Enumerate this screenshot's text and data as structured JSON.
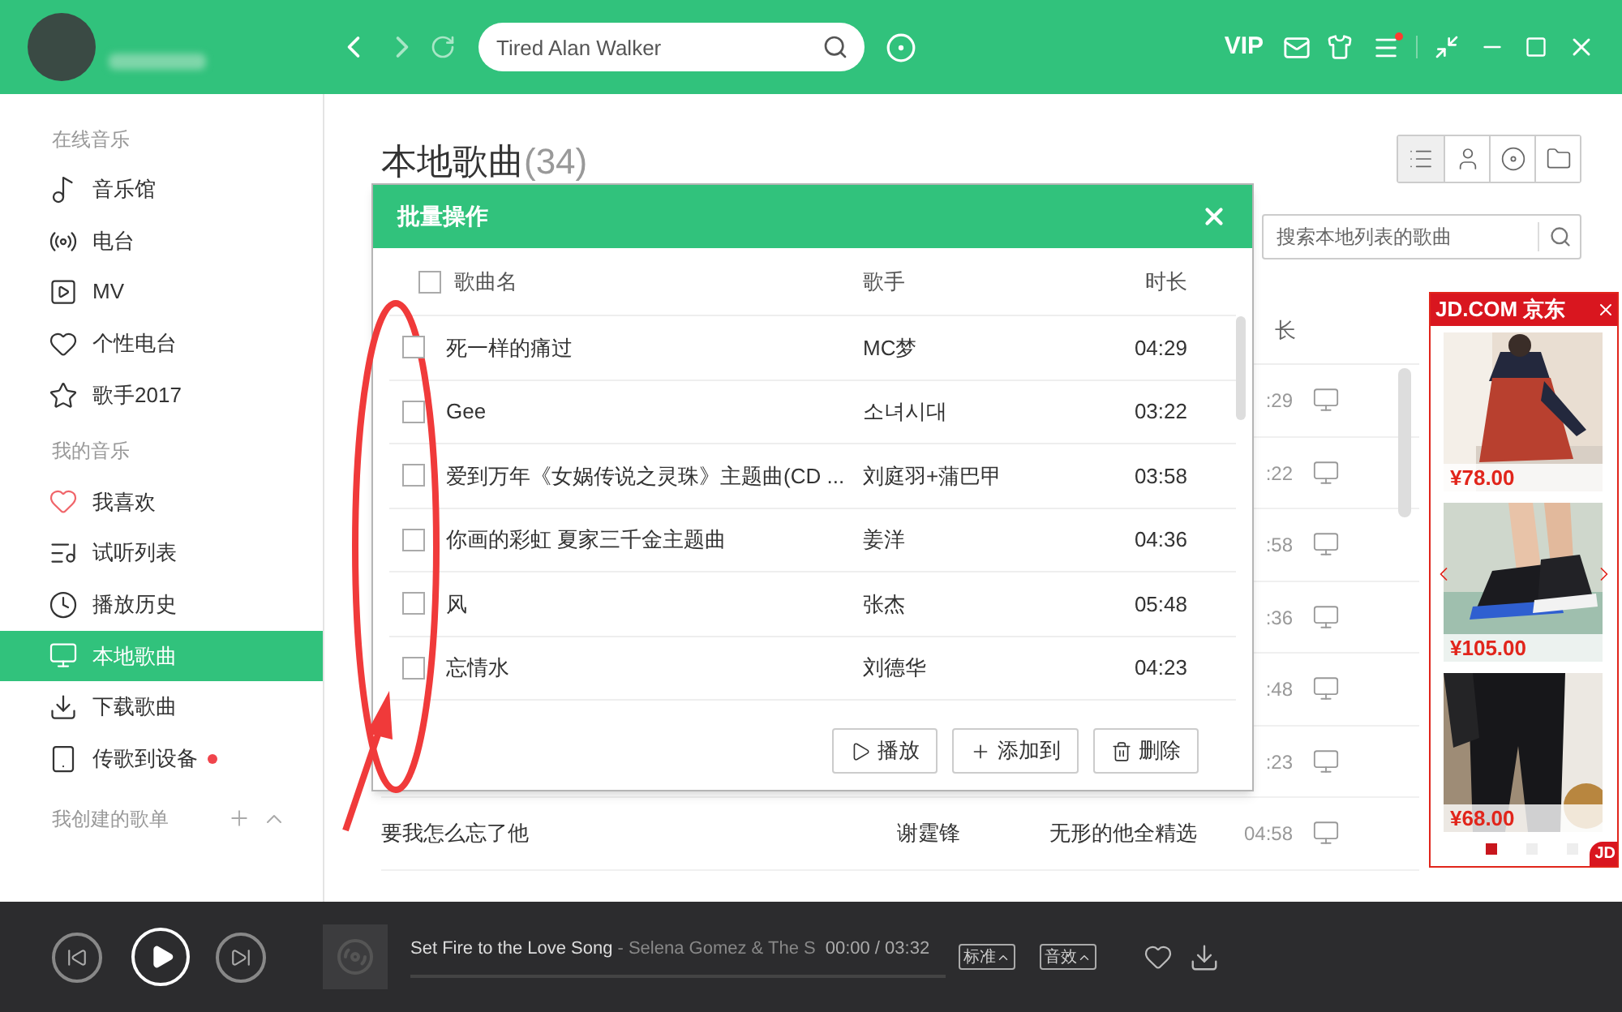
{
  "top_bar": {
    "search": {
      "placeholder": "Tired Alan Walker"
    },
    "vip": "VIP",
    "menu_badge": true
  },
  "sidebar": {
    "sections": [
      {
        "title": "在线音乐",
        "items": [
          {
            "kind": "music",
            "label": "音乐馆",
            "selected": false,
            "badge": false
          },
          {
            "kind": "radio",
            "label": "电台",
            "selected": false,
            "badge": false
          },
          {
            "kind": "mv",
            "label": "MV",
            "selected": false,
            "badge": false
          },
          {
            "kind": "personal",
            "label": "个性电台",
            "selected": false,
            "badge": false
          },
          {
            "kind": "star",
            "label": "歌手2017",
            "selected": false,
            "badge": false
          }
        ]
      },
      {
        "title": "我的音乐",
        "items": [
          {
            "kind": "like",
            "label": "我喜欢",
            "selected": false,
            "badge": false
          },
          {
            "kind": "trial",
            "label": "试听列表",
            "selected": false,
            "badge": false
          },
          {
            "kind": "history",
            "label": "播放历史",
            "selected": false,
            "badge": false
          },
          {
            "kind": "local",
            "label": "本地歌曲",
            "selected": true,
            "badge": false
          },
          {
            "kind": "download",
            "label": "下载歌曲",
            "selected": false,
            "badge": false
          },
          {
            "kind": "device",
            "label": "传歌到设备",
            "selected": false,
            "badge": true
          }
        ]
      }
    ],
    "playlists_title": "我创建的歌单"
  },
  "page": {
    "title": "本地歌曲",
    "count": "(34)",
    "view_buttons": [
      {
        "kind": "list",
        "selected": true
      },
      {
        "kind": "singer",
        "selected": false
      },
      {
        "kind": "album",
        "selected": false
      },
      {
        "kind": "folder",
        "selected": false
      }
    ],
    "search": {
      "placeholder": "搜索本地列表的歌曲"
    }
  },
  "background_list": {
    "header_fragment": "长",
    "rows": [
      {
        "duration": ":29"
      },
      {
        "duration": ":22"
      },
      {
        "duration": ":58"
      },
      {
        "duration": ":36"
      },
      {
        "duration": ":48"
      },
      {
        "duration": ":23"
      },
      {
        "title": "要我怎么忘了他",
        "artist": "谢霆锋",
        "album": "无形的他全精选",
        "duration": "04:58"
      }
    ]
  },
  "dialog": {
    "title": "批量操作",
    "select_all": false,
    "columns": [
      "歌曲名",
      "歌手",
      "时长"
    ],
    "rows": [
      {
        "title": "死一样的痛过",
        "artist": "MC梦",
        "duration": "04:29",
        "checked": false
      },
      {
        "title": "Gee",
        "artist": "소녀시대",
        "duration": "03:22",
        "checked": false
      },
      {
        "title": "爱到万年《女娲传说之灵珠》主题曲(CD ...",
        "artist": "刘庭羽+蒲巴甲",
        "duration": "03:58",
        "checked": false
      },
      {
        "title": "你画的彩虹 夏家三千金主题曲",
        "artist": "姜洋",
        "duration": "04:36",
        "checked": false
      },
      {
        "title": "风",
        "artist": "张杰",
        "duration": "05:48",
        "checked": false
      },
      {
        "title": "忘情水",
        "artist": "刘德华",
        "duration": "04:23",
        "checked": false
      }
    ],
    "buttons": [
      {
        "kind": "play",
        "label": "播放"
      },
      {
        "kind": "add",
        "label": "添加到"
      },
      {
        "kind": "delete",
        "label": "删除"
      }
    ]
  },
  "ad": {
    "brand": "JD.COM 京东",
    "products": [
      {
        "price": "¥78.00"
      },
      {
        "price": "¥105.00"
      },
      {
        "price": "¥68.00"
      }
    ],
    "dots": [
      {
        "selected": true
      },
      {
        "selected": false
      },
      {
        "selected": false
      }
    ],
    "corner": "JD"
  },
  "player": {
    "song": "Set Fire to the Love Song",
    "artist": "- Selena Gomez & The S",
    "time": "00:00 / 03:32",
    "level": 0,
    "quality": "标准",
    "effect": "音效",
    "liked": false
  }
}
